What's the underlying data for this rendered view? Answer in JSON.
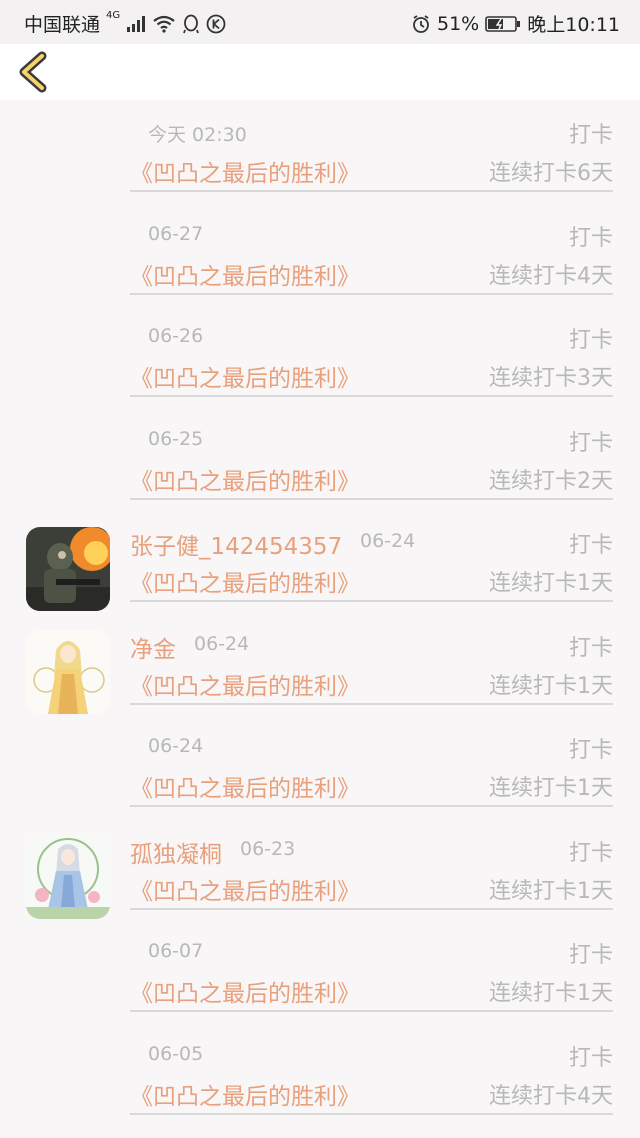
{
  "status_bar": {
    "carrier": "中国联通",
    "network": "4G",
    "battery": "51%",
    "time": "晚上10:11"
  },
  "nav": {
    "back_icon": "chevron-left-icon",
    "accent": "#f5d36a"
  },
  "colors": {
    "accent_text": "#e8a07d",
    "muted_text": "#b8b8b8"
  },
  "entries": [
    {
      "name": "",
      "date": "今天 02:30",
      "action": "打卡",
      "book": "《凹凸之最后的胜利》",
      "streak": "连续打卡6天",
      "avatar": null
    },
    {
      "name": "",
      "date": "06-27",
      "action": "打卡",
      "book": "《凹凸之最后的胜利》",
      "streak": "连续打卡4天",
      "avatar": null
    },
    {
      "name": "",
      "date": "06-26",
      "action": "打卡",
      "book": "《凹凸之最后的胜利》",
      "streak": "连续打卡3天",
      "avatar": null
    },
    {
      "name": "",
      "date": "06-25",
      "action": "打卡",
      "book": "《凹凸之最后的胜利》",
      "streak": "连续打卡2天",
      "avatar": null
    },
    {
      "name": "张子健_142454357",
      "date": "06-24",
      "action": "打卡",
      "book": "《凹凸之最后的胜利》",
      "streak": "连续打卡1天",
      "avatar": "soldier"
    },
    {
      "name": "净金",
      "date": "06-24",
      "action": "打卡",
      "book": "《凹凸之最后的胜利》",
      "streak": "连续打卡1天",
      "avatar": "anime-gold"
    },
    {
      "name": "",
      "date": "06-24",
      "action": "打卡",
      "book": "《凹凸之最后的胜利》",
      "streak": "连续打卡1天",
      "avatar": null
    },
    {
      "name": "孤独凝桐",
      "date": "06-23",
      "action": "打卡",
      "book": "《凹凸之最后的胜利》",
      "streak": "连续打卡1天",
      "avatar": "anime-blue"
    },
    {
      "name": "",
      "date": "06-07",
      "action": "打卡",
      "book": "《凹凸之最后的胜利》",
      "streak": "连续打卡1天",
      "avatar": null
    },
    {
      "name": "",
      "date": "06-05",
      "action": "打卡",
      "book": "《凹凸之最后的胜利》",
      "streak": "连续打卡4天",
      "avatar": null
    }
  ]
}
